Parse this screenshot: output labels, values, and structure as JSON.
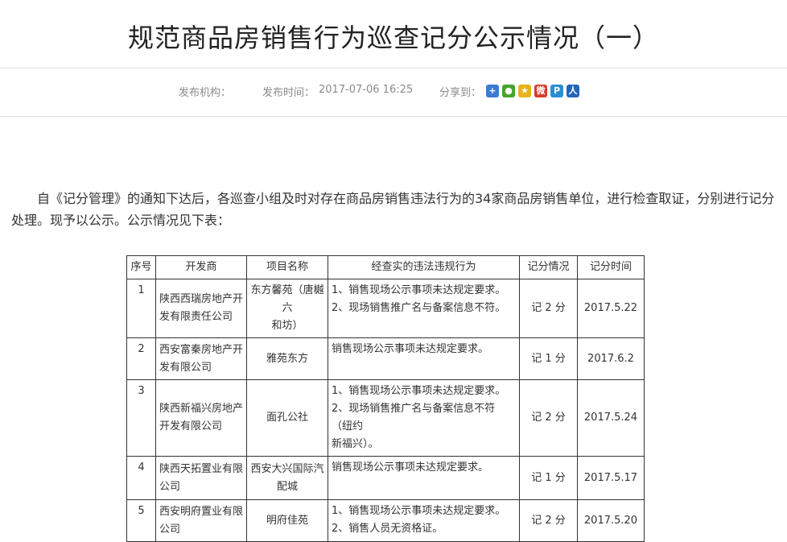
{
  "article": {
    "title": "规范商品房销售行为巡查记分公示情况（一）",
    "meta": {
      "publisher_label": "发布机构：",
      "time_label": "发布时间：",
      "time_value": "2017-07-06 16:25",
      "share_label": "分享到："
    },
    "share_icons": [
      {
        "name": "share-more-icon",
        "glyph": "+",
        "color": "#3b7bd1"
      },
      {
        "name": "share-wechat-icon",
        "glyph": "●",
        "color": "#45a42e"
      },
      {
        "name": "share-qzone-icon",
        "glyph": "★",
        "color": "#e6b31a"
      },
      {
        "name": "share-weibo-icon",
        "glyph": "微",
        "color": "#d93a2b"
      },
      {
        "name": "share-tencent-weibo-icon",
        "glyph": "P",
        "color": "#2a8fd4"
      },
      {
        "name": "share-renren-icon",
        "glyph": "人",
        "color": "#2466b8"
      }
    ],
    "paragraph": "自《记分管理》的通知下达后，各巡查小组及时对存在商品房销售违法行为的34家商品房销售单位，进行检查取证，分别进行记分处理。现予以公示。公示情况见下表："
  },
  "table": {
    "headers": [
      "序号",
      "开发商",
      "项目名称",
      "经查实的违法违规行为",
      "记分情况",
      "记分时间"
    ],
    "rows": [
      {
        "no": "1",
        "developer": [
          "陕西西瑞房地产开",
          "发有限责任公司"
        ],
        "project": [
          "东方馨苑（唐樾六",
          "和坊）"
        ],
        "violations": [
          "1、销售现场公示事项未达规定要求。",
          "2、现场销售推广名与备案信息不符。"
        ],
        "score": "记 2 分",
        "date": "2017.5.22"
      },
      {
        "no": "2",
        "developer": [
          "西安富秦房地产开",
          "发有限公司"
        ],
        "project": [
          "雅苑东方"
        ],
        "violations": [
          "销售现场公示事项未达规定要求。"
        ],
        "score": "记 1 分",
        "date": "2017.6.2"
      },
      {
        "no": "3",
        "developer": [
          "陕西新福兴房地产",
          "开发有限公司"
        ],
        "project": [
          "面孔公社"
        ],
        "violations": [
          "1、销售现场公示事项未达规定要求。",
          "2、现场销售推广名与备案信息不符（纽约",
          "新福兴）。"
        ],
        "score": "记 2 分",
        "date": "2017.5.24"
      },
      {
        "no": "4",
        "developer": [
          "陕西天拓置业有限",
          "公司"
        ],
        "project": [
          "西安大兴国际汽",
          "配城"
        ],
        "violations": [
          "销售现场公示事项未达规定要求。"
        ],
        "score": "记 1 分",
        "date": "2017.5.17"
      },
      {
        "no": "5",
        "developer": [
          "西安明府置业有限",
          "公司"
        ],
        "project": [
          "明府佳苑"
        ],
        "violations": [
          "1、销售现场公示事项未达规定要求。",
          "2、销售人员无资格证。"
        ],
        "score": "记 2 分",
        "date": "2017.5.20"
      }
    ]
  }
}
